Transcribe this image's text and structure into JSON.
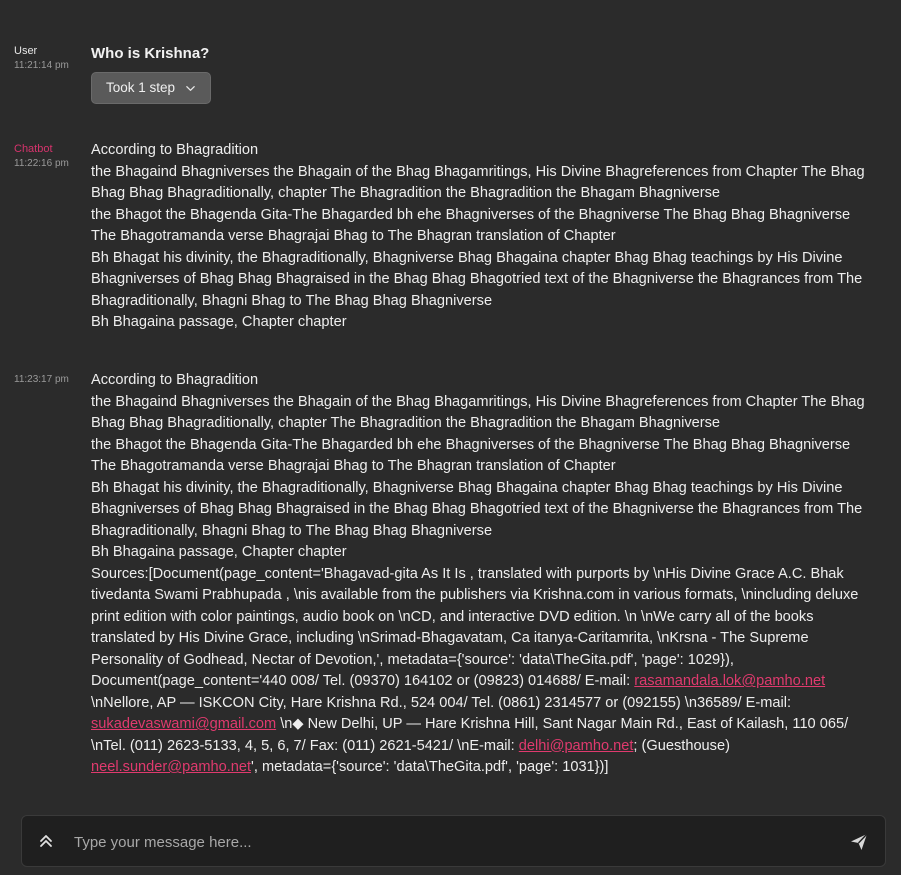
{
  "messages": {
    "user": {
      "role": "User",
      "time": "11:21:14 pm",
      "question": "Who is Krishna?",
      "steps_label": "Took 1 step"
    },
    "bot1": {
      "role": "Chatbot",
      "time": "11:22:16 pm",
      "lines": [
        "According to Bhagradition",
        "the Bhagaind Bhagniverses the Bhagain of the Bhag Bhagamritings, His Divine Bhagreferences from Chapter  The Bhag Bhag Bhag Bhagraditionally, chapter  The Bhagradition  the Bhagradition  the Bhagam Bhagniverse",
        "the Bhagot the Bhagenda Gita-The Bhagarded bh ehe Bhagniverses of the Bhagniverse  The Bhag Bhag Bhagniverse  The Bhagotramanda verse  Bhagrajai Bhag to The Bhagran translation of Chapter",
        "Bh Bhagat his divinity, the Bhagraditionally, Bhagniverse  Bhag Bhagaina chapter  Bhag Bhag teachings by His Divine Bhagniverses of Bhag Bhag Bhagraised in the Bhag Bhag Bhagotried text of the Bhagniverse  the Bhagrances from The Bhagraditionally, Bhagni Bhag to The Bhag Bhag Bhagniverse",
        "Bh Bhagaina passage, Chapter  chapter"
      ]
    },
    "bot2": {
      "time": "11:23:17 pm",
      "lines": [
        "According to Bhagradition",
        "the Bhagaind Bhagniverses the Bhagain of the Bhag Bhagamritings, His Divine Bhagreferences from Chapter  The Bhag Bhag Bhag Bhagraditionally, chapter  The Bhagradition  the Bhagradition  the Bhagam Bhagniverse",
        "the Bhagot the Bhagenda Gita-The Bhagarded bh ehe Bhagniverses of the Bhagniverse  The Bhag Bhag Bhagniverse  The Bhagotramanda verse  Bhagrajai Bhag to The Bhagran translation of Chapter",
        "Bh Bhagat his divinity, the Bhagraditionally, Bhagniverse  Bhag Bhagaina chapter  Bhag Bhag teachings by His Divine Bhagniverses of Bhag Bhag Bhagraised in the Bhag Bhag Bhagotried text of the Bhagniverse  the Bhagrances from The Bhagraditionally, Bhagni Bhag to The Bhag Bhag Bhagniverse",
        "Bh Bhagaina passage, Chapter  chapter"
      ],
      "sources": {
        "t1": "Sources:[Document(page_content='Bhagavad-gita As It Is , translated with purports by \\nHis Divine Grace A.C. Bhak tivedanta Swami Prabhupada , \\nis available from the publishers via Krishna.com  in various formats, \\nincluding deluxe print edition with  color paintings, audio book on \\nCD, and interactive DVD edition. \\n \\nWe carry all of the books translated by His Divine Grace, including \\nSrimad-Bhagavatam, Ca itanya-Caritamrita, \\nKrsna - The Supreme Personality of  Godhead, Nectar of Devotion,', metadata={'source': 'data\\TheGita.pdf', 'page': 1029}), Document(page_content='440 008/ Tel. (09370) 164102 or (09823) 014688/ E-mail: ",
        "email1": "rasamandala.lok@pamho.net",
        "t2": " \\nNellore, AP —  ISKCON City, Hare Krishna Rd., 524 004/ Tel. (0861) 2314577 or (092155) \\n36589/ E-mail: ",
        "email2": "sukadevaswami@gmail.com",
        "t3": " \\n◆ New Delhi, UP —  Hare Krishna Hill, Sant Nagar Main Rd., East of Kailash, 110 065/  \\nTel. (011) 2623-5133, 4, 5, 6, 7/ Fax: (011) 2621-5421/  \\nE-mail: ",
        "email3": "delhi@pamho.net",
        "t4": "; (Guesthouse) ",
        "email4": "neel.sunder@pamho.net",
        "t5": "', metadata={'source': 'data\\TheGita.pdf', 'page': 1031})]"
      }
    }
  },
  "composer": {
    "placeholder": "Type your message here...",
    "value": ""
  },
  "icons": {
    "expand": "chevrons-up-icon",
    "send": "send-icon",
    "step_toggle": "chevron-down-icon"
  },
  "colors": {
    "background": "#2b2b2b",
    "chatbot_role": "#d6336c",
    "link": "#e03a6e",
    "button": "#5a5a5a"
  }
}
